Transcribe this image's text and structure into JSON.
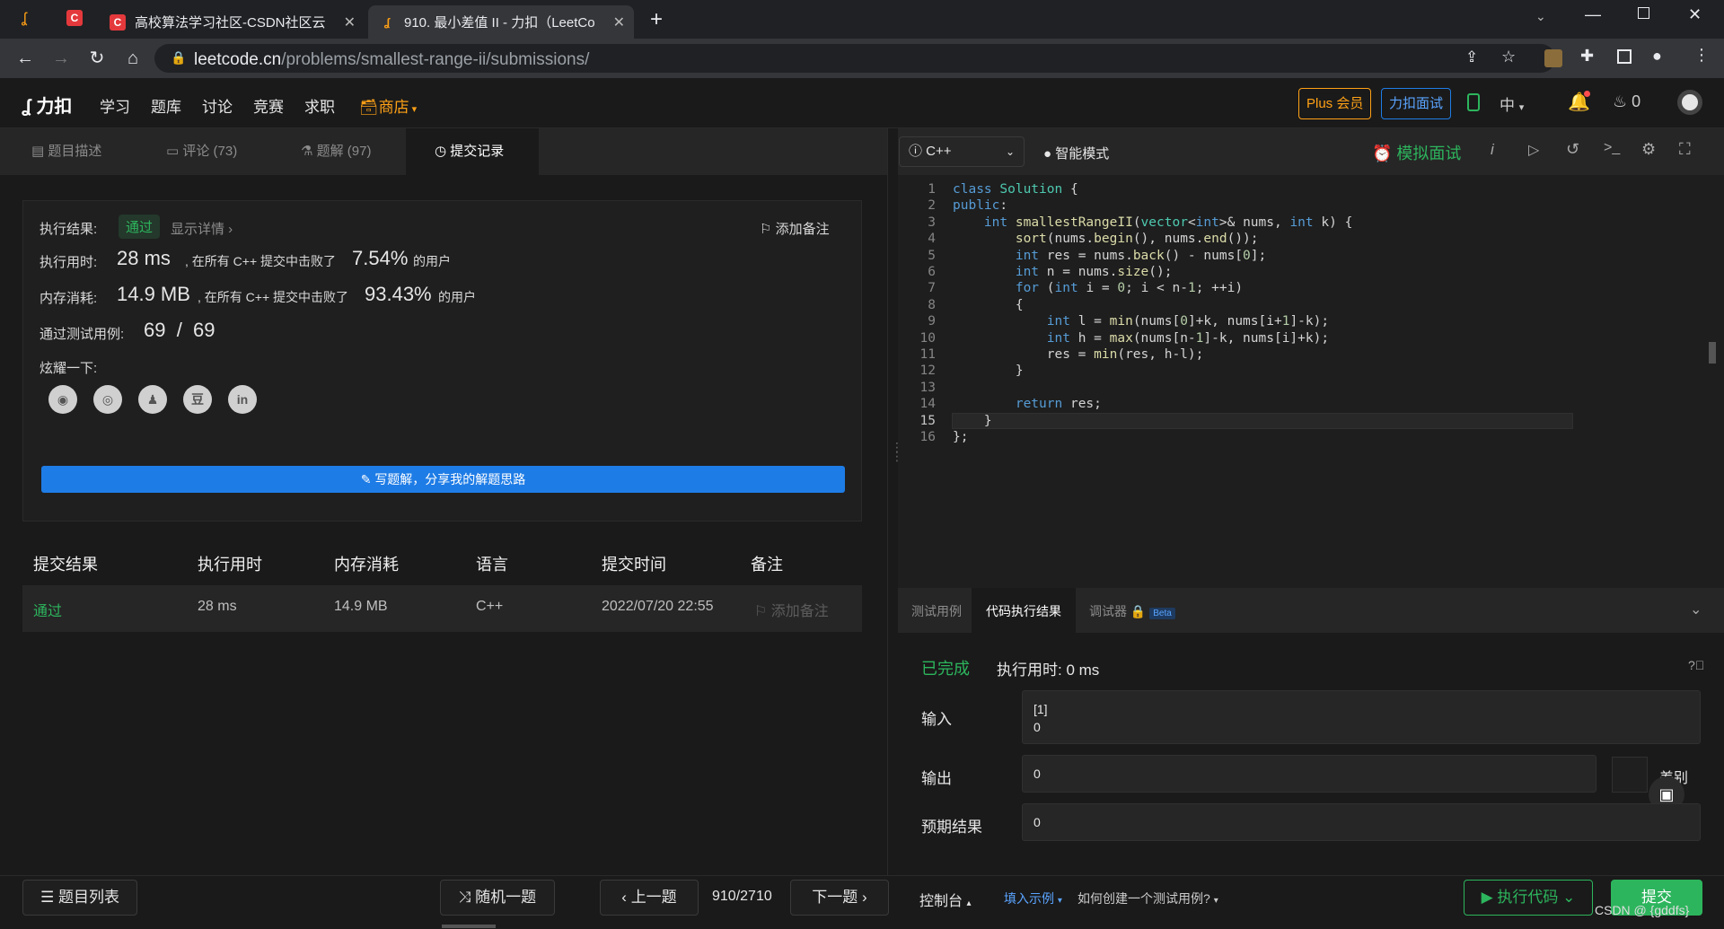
{
  "browser": {
    "tabs": [
      {
        "title": "高校算法学习社区-CSDN社区云",
        "favicon": "C"
      },
      {
        "title": "910. 最小差值 II - 力扣（LeetCo",
        "favicon": "leetcode"
      }
    ],
    "url_host": "leetcode.cn",
    "url_path": "/problems/smallest-range-ii/submissions/"
  },
  "site_nav": {
    "brand": "力扣",
    "links": [
      "学习",
      "题库",
      "讨论",
      "竞赛",
      "求职"
    ],
    "store": "商店",
    "plus": "Plus 会员",
    "interview": "力扣面试",
    "lang": "中",
    "points": "0"
  },
  "left_tabs": {
    "description": "题目描述",
    "comments": "评论 (73)",
    "solutions": "题解 (97)",
    "submissions": "提交记录"
  },
  "result": {
    "label_result": "执行结果:",
    "status": "通过",
    "show_detail": "显示详情 ›",
    "add_note": "添加备注",
    "label_time": "执行用时:",
    "time_value": "28 ms",
    "time_text": ", 在所有 C++ 提交中击败了",
    "time_percent": "7.54%",
    "users": "的用户",
    "label_memory": "内存消耗:",
    "memory_value": "14.9 MB",
    "memory_text": ", 在所有 C++ 提交中击败了",
    "memory_percent": "93.43%",
    "label_tests": "通过测试用例:",
    "tests_value": "69  /  69",
    "label_share": "炫耀一下:",
    "write_solution": "写题解，分享我的解题思路"
  },
  "submissions_table": {
    "headers": [
      "提交结果",
      "执行用时",
      "内存消耗",
      "语言",
      "提交时间",
      "备注"
    ],
    "rows": [
      {
        "result": "通过",
        "time": "28 ms",
        "memory": "14.9 MB",
        "language": "C++",
        "submitted": "2022/07/20 22:55",
        "note": "添加备注"
      }
    ]
  },
  "editor": {
    "language": "C++",
    "smart_mode": "智能模式",
    "mock_interview": "模拟面试"
  },
  "code_lines": [
    "class Solution {",
    "public:",
    "    int smallestRangeII(vector<int>& nums, int k) {",
    "        sort(nums.begin(), nums.end());",
    "        int res = nums.back() - nums[0];",
    "        int n = nums.size();",
    "        for (int i = 0; i < n-1; ++i)",
    "        {",
    "            int l = min(nums[0]+k, nums[i+1]-k);",
    "            int h = max(nums[n-1]-k, nums[i]+k);",
    "            res = min(res, h-l);",
    "        }",
    "",
    "        return res;",
    "    }",
    "};"
  ],
  "console_tabs": {
    "testcase": "测试用例",
    "result": "代码执行结果",
    "debugger": "调试器",
    "beta": "Beta"
  },
  "run_result": {
    "status": "已完成",
    "time": "执行用时: 0 ms",
    "input_label": "输入",
    "input_value": "[1]\n0",
    "output_label": "输出",
    "output_value": "0",
    "expected_label": "预期结果",
    "expected_value": "0",
    "diff": "差别"
  },
  "footer": {
    "problem_list": "题目列表",
    "random": "随机一题",
    "prev": "上一题",
    "counter": "910/2710",
    "next": "下一题",
    "console": "控制台",
    "fill_example": "填入示例",
    "how_create": "如何创建一个测试用例?",
    "run_code": "执行代码",
    "submit": "提交",
    "watermark": "CSDN @ {gddfs}"
  },
  "colors": {
    "accent_green": "#2db55d",
    "accent_blue": "#1e7ce6",
    "store_orange": "#ffa116"
  }
}
